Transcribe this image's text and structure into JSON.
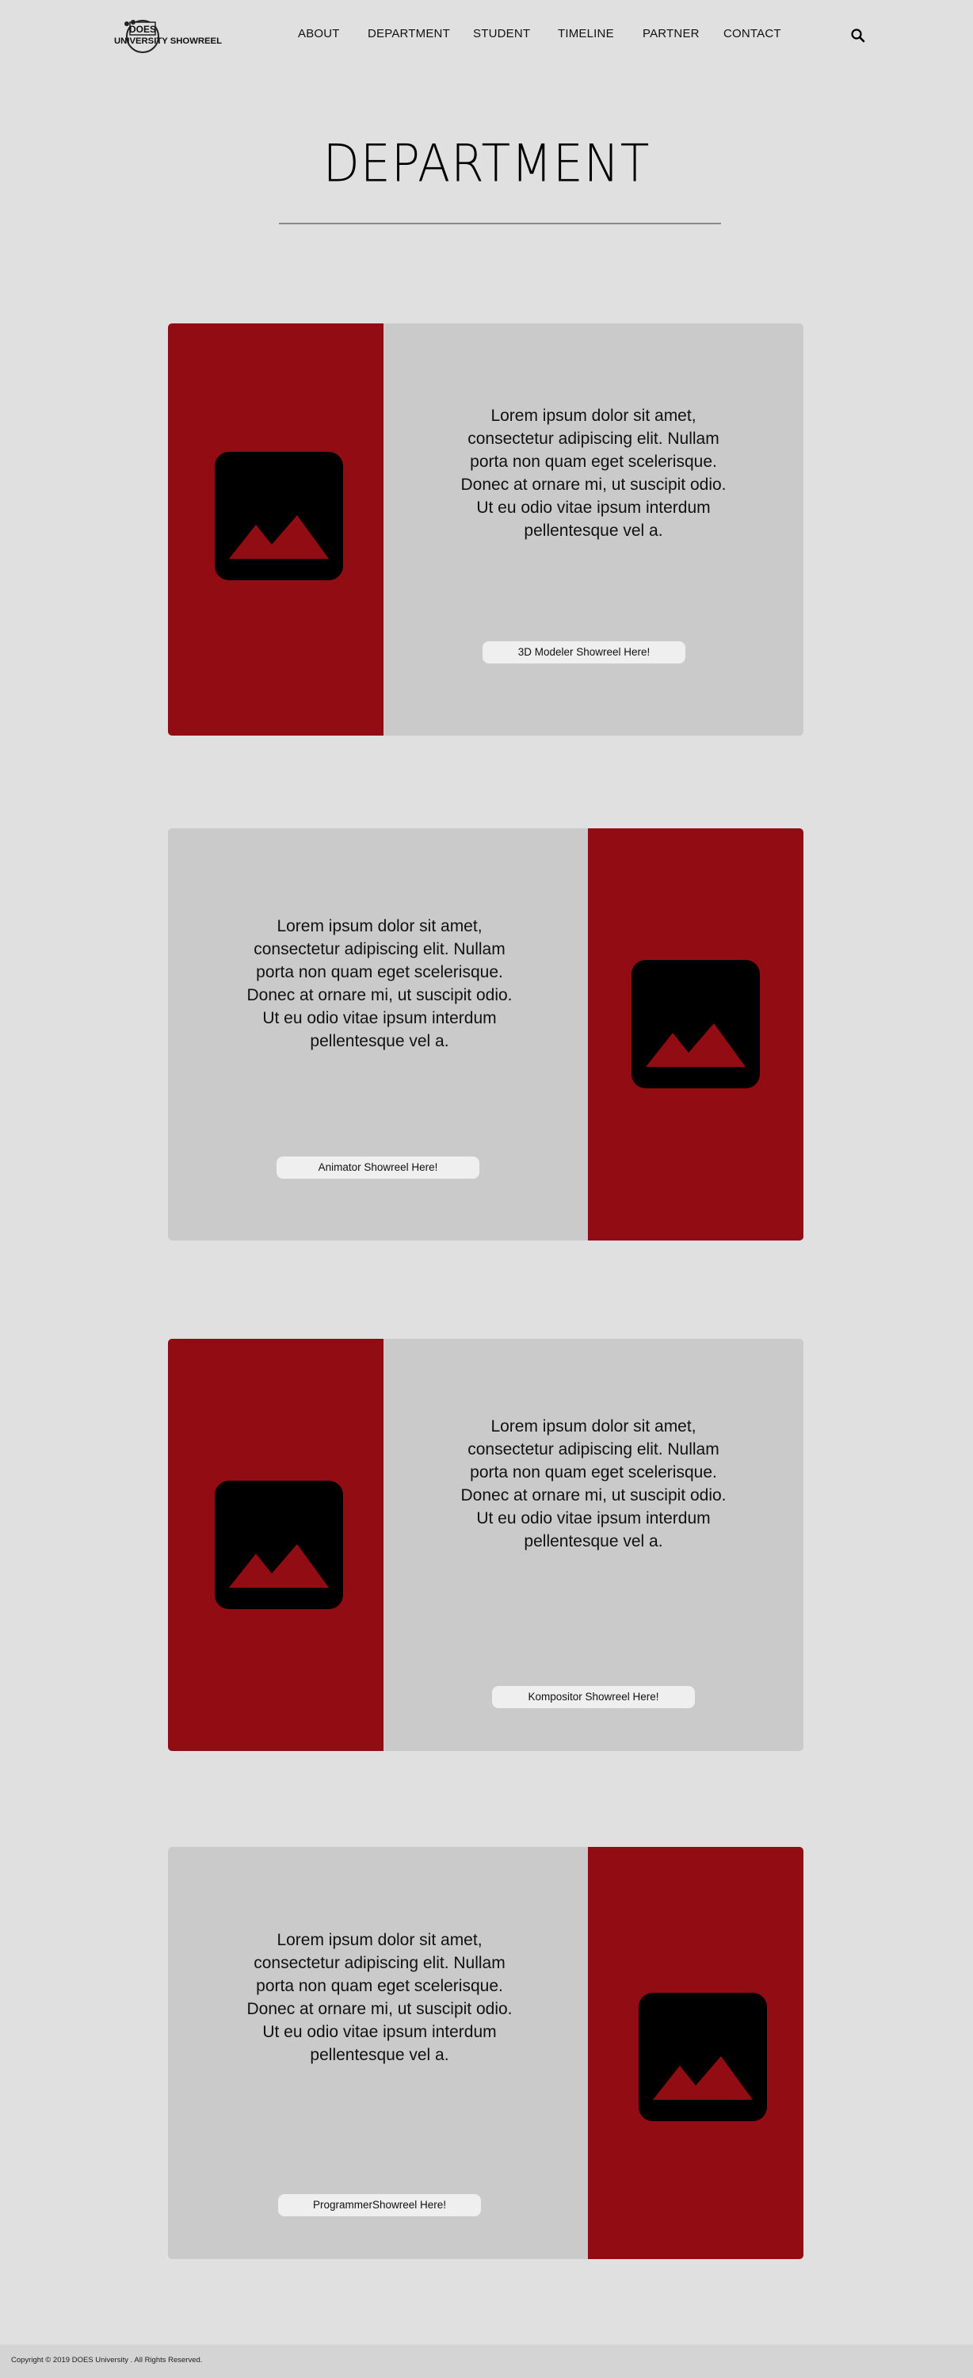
{
  "header": {
    "logo": {
      "top_text": "DOES",
      "main_text": "UNIVERSITY SHOWREEL"
    },
    "nav": [
      {
        "label": "ABOUT"
      },
      {
        "label": "DEPARTMENT"
      },
      {
        "label": "STUDENT"
      },
      {
        "label": "TIMELINE"
      },
      {
        "label": "PARTNER"
      },
      {
        "label": "CONTACT"
      }
    ],
    "search_icon": "search-icon"
  },
  "main": {
    "title": "DEPARTMENT",
    "cards": [
      {
        "text": "Lorem ipsum dolor sit amet, consectetur adipiscing elit. Nullam porta non quam eget scelerisque. Donec at ornare mi, ut suscipit odio. Ut eu odio vitae ipsum interdum pellentesque vel a.",
        "button_label": "3D Modeler Showreel Here!",
        "image_icon": "image-placeholder-icon"
      },
      {
        "text": "Lorem ipsum dolor sit amet, consectetur adipiscing elit. Nullam porta non quam eget scelerisque. Donec at ornare mi, ut suscipit odio. Ut eu odio vitae ipsum interdum pellentesque vel a.",
        "button_label": "Animator Showreel Here!",
        "image_icon": "image-placeholder-icon"
      },
      {
        "text": "Lorem ipsum dolor sit amet, consectetur adipiscing elit. Nullam porta non quam eget scelerisque. Donec at ornare mi, ut suscipit odio. Ut eu odio vitae ipsum interdum pellentesque vel a.",
        "button_label": "Kompositor Showreel Here!",
        "image_icon": "image-placeholder-icon"
      },
      {
        "text": "Lorem ipsum dolor sit amet, consectetur adipiscing elit. Nullam porta non quam eget scelerisque. Donec at ornare mi, ut suscipit odio. Ut eu odio vitae ipsum interdum pellentesque vel a.",
        "button_label": "ProgrammerShowreel Here!",
        "image_icon": "image-placeholder-icon"
      }
    ]
  },
  "footer": {
    "copyright": "Copyright © 2019 DOES University . All Rights Reserved."
  },
  "colors": {
    "background": "#e0e0e0",
    "card_background": "#cacaca",
    "accent_red": "#920d13",
    "button_background": "#efefef"
  }
}
